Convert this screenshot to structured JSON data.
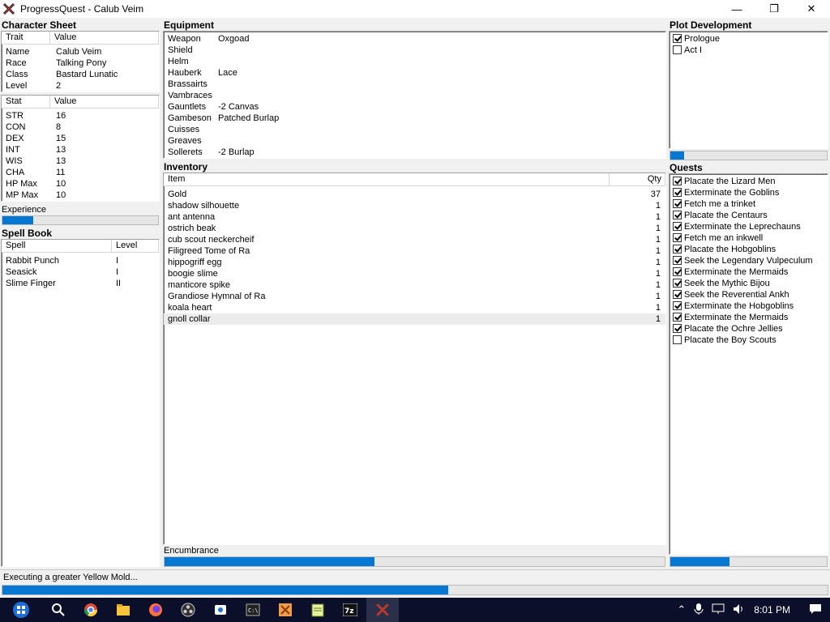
{
  "window": {
    "title": "ProgressQuest - Calub Veim"
  },
  "character_sheet": {
    "title": "Character Sheet",
    "traits_header": [
      "Trait",
      "Value"
    ],
    "traits": [
      [
        "Name",
        "Calub Veim"
      ],
      [
        "Race",
        "Talking Pony"
      ],
      [
        "Class",
        "Bastard Lunatic"
      ],
      [
        "Level",
        "2"
      ]
    ],
    "stats_header": [
      "Stat",
      "Value"
    ],
    "stats": [
      [
        "STR",
        "16"
      ],
      [
        "CON",
        "8"
      ],
      [
        "DEX",
        "15"
      ],
      [
        "INT",
        "13"
      ],
      [
        "WIS",
        "13"
      ],
      [
        "CHA",
        "11"
      ],
      [
        "HP Max",
        "10"
      ],
      [
        "MP Max",
        "10"
      ]
    ],
    "experience_label": "Experience",
    "experience_progress": 0.2
  },
  "spell_book": {
    "title": "Spell Book",
    "header": [
      "Spell",
      "Level"
    ],
    "spells": [
      [
        "Rabbit Punch",
        "I"
      ],
      [
        "Seasick",
        "I"
      ],
      [
        "Slime Finger",
        "II"
      ]
    ]
  },
  "equipment": {
    "title": "Equipment",
    "items": [
      [
        "Weapon",
        "Oxgoad"
      ],
      [
        "Shield",
        ""
      ],
      [
        "Helm",
        ""
      ],
      [
        "Hauberk",
        "Lace"
      ],
      [
        "Brassairts",
        ""
      ],
      [
        "Vambraces",
        ""
      ],
      [
        "Gauntlets",
        "-2 Canvas"
      ],
      [
        "Gambeson",
        "Patched Burlap"
      ],
      [
        "Cuisses",
        ""
      ],
      [
        "Greaves",
        ""
      ],
      [
        "Sollerets",
        "-2 Burlap"
      ]
    ]
  },
  "inventory": {
    "title": "Inventory",
    "header": [
      "Item",
      "Qty"
    ],
    "items": [
      [
        "Gold",
        "37"
      ],
      [
        "shadow silhouette",
        "1"
      ],
      [
        "ant antenna",
        "1"
      ],
      [
        "ostrich beak",
        "1"
      ],
      [
        "cub scout neckercheif",
        "1"
      ],
      [
        "Filigreed Tome of Ra",
        "1"
      ],
      [
        "hippogriff egg",
        "1"
      ],
      [
        "boogie slime",
        "1"
      ],
      [
        "manticore spike",
        "1"
      ],
      [
        "Grandiose Hymnal of Ra",
        "1"
      ],
      [
        "koala heart",
        "1"
      ],
      [
        "gnoll collar",
        "1"
      ]
    ],
    "encumbrance_label": "Encumbrance",
    "encumbrance_progress": 0.42
  },
  "plot": {
    "title": "Plot Development",
    "acts": [
      {
        "label": "Prologue",
        "checked": true
      },
      {
        "label": "Act I",
        "checked": false
      }
    ],
    "progress": 0.09
  },
  "quests": {
    "title": "Quests",
    "items": [
      {
        "label": "Placate the Lizard Men",
        "checked": true
      },
      {
        "label": "Exterminate the Goblins",
        "checked": true
      },
      {
        "label": "Fetch me a trinket",
        "checked": true
      },
      {
        "label": "Placate the Centaurs",
        "checked": true
      },
      {
        "label": "Exterminate the Leprechauns",
        "checked": true
      },
      {
        "label": "Fetch me an inkwell",
        "checked": true
      },
      {
        "label": "Placate the Hobgoblins",
        "checked": true
      },
      {
        "label": "Seek the Legendary Vulpeculum",
        "checked": true
      },
      {
        "label": "Exterminate the Mermaids",
        "checked": true
      },
      {
        "label": "Seek the Mythic Bijou",
        "checked": true
      },
      {
        "label": "Seek the Reverential Ankh",
        "checked": true
      },
      {
        "label": "Exterminate the Hobgoblins",
        "checked": true
      },
      {
        "label": "Exterminate the Mermaids",
        "checked": true
      },
      {
        "label": "Placate the Ochre Jellies",
        "checked": true
      },
      {
        "label": "Placate the Boy Scouts",
        "checked": false
      }
    ],
    "progress": 0.38
  },
  "status": {
    "text": "Executing a greater Yellow Mold...",
    "progress": 0.54
  },
  "taskbar": {
    "clock": "8:01 PM"
  },
  "colors": {
    "progress": "#0678d4"
  }
}
